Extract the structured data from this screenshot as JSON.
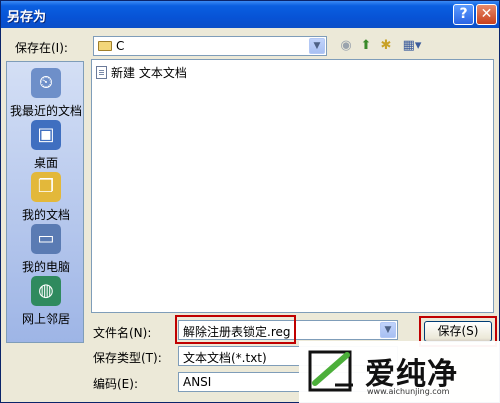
{
  "window": {
    "title": "另存为",
    "help": "?",
    "close": "✕"
  },
  "location": {
    "label": "保存在(I):",
    "value": "C"
  },
  "toolbar": {
    "back": "◉",
    "up": "⬆",
    "new_folder": "✱",
    "views": "▦▾"
  },
  "places": [
    {
      "label": "我最近的文档",
      "icon": "recent-docs-icon",
      "glyph": "⏲"
    },
    {
      "label": "桌面",
      "icon": "desktop-icon",
      "glyph": "▣"
    },
    {
      "label": "我的文档",
      "icon": "my-documents-icon",
      "glyph": "❐"
    },
    {
      "label": "我的电脑",
      "icon": "my-computer-icon",
      "glyph": "▭"
    },
    {
      "label": "网上邻居",
      "icon": "network-icon",
      "glyph": "◍"
    }
  ],
  "files": [
    {
      "name": "新建 文本文档"
    }
  ],
  "filename": {
    "label": "文件名(N):",
    "value": "解除注册表锁定.reg"
  },
  "filetype": {
    "label": "保存类型(T):",
    "value": "文本文档(*.txt)"
  },
  "encoding": {
    "label": "编码(E):",
    "value": "ANSI"
  },
  "buttons": {
    "save": "保存(S)"
  },
  "watermark": {
    "name": "爱纯净",
    "url": "www.aichunjing.com"
  },
  "colors": {
    "title_bar": "#0753d6",
    "dialog_bg": "#ece9d8",
    "highlight": "#c00000"
  }
}
